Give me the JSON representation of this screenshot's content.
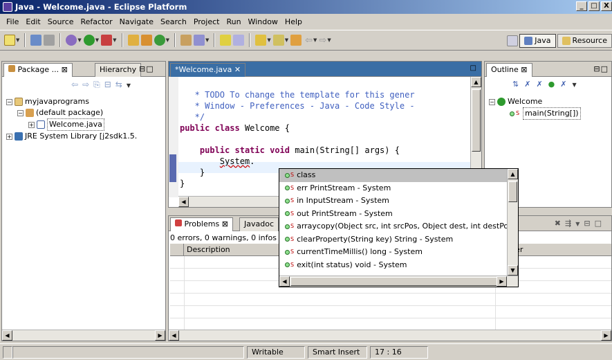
{
  "window": {
    "title": "Java - Welcome.java - Eclipse Platform",
    "controls": [
      "_",
      "□",
      "X"
    ]
  },
  "menu": [
    "File",
    "Edit",
    "Source",
    "Refactor",
    "Navigate",
    "Search",
    "Project",
    "Run",
    "Window",
    "Help"
  ],
  "perspectives": {
    "java": "Java",
    "resource": "Resource"
  },
  "package_panel": {
    "tab_package": "Package ... ⊠",
    "tab_hierarchy": "Hierarchy",
    "tree": [
      "myjavaprograms",
      "(default package)",
      "Welcome.java",
      "JRE System Library [j2sdk1.5."
    ]
  },
  "editor": {
    "tab": "*Welcome.java ✕",
    "lines": [
      "   * TODO To change the template for this gener",
      "   * Window - Preferences - Java - Code Style -",
      "   */",
      "public class Welcome {",
      "",
      "    public static void main(String[] args) {",
      "        System.",
      "    }",
      "}"
    ]
  },
  "outline": {
    "tab": "Outline ⊠",
    "class_name": "Welcome",
    "method": "main(String[])"
  },
  "problems": {
    "tab_problems": "Problems ⊠",
    "tab_javadoc": "Javadoc",
    "summary": "0 errors, 0 warnings, 0 infos",
    "col_description": "Description",
    "col_folder": "ler"
  },
  "completion": [
    "class",
    "err  PrintStream - System",
    "in  InputStream - System",
    "out  PrintStream - System",
    "arraycopy(Object src, int srcPos, Object dest, int destPos,",
    "clearProperty(String key)  String - System",
    "currentTimeMillis()  long - System",
    "exit(int status)  void - System"
  ],
  "status": {
    "writable": "Writable",
    "insert": "Smart Insert",
    "position": "17 : 16"
  },
  "colors": {
    "title_start": "#0a246a",
    "title_end": "#a6caf0",
    "keyword": "#7f0055",
    "comment": "#3f5fbf"
  }
}
